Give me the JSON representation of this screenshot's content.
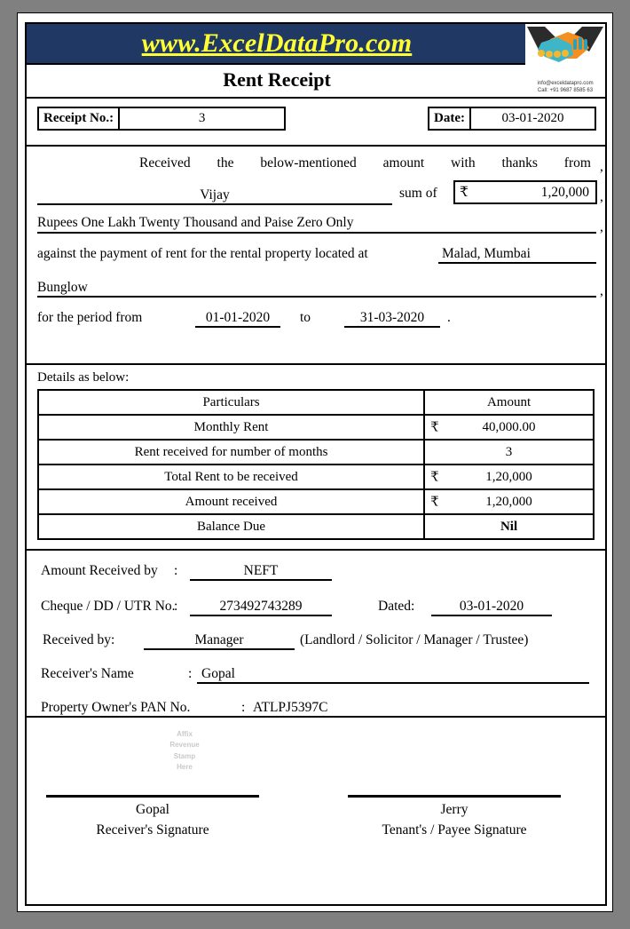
{
  "header": {
    "website": "www.ExcelDataPro.com",
    "doc_title": "Rent Receipt",
    "logo_icon": "handshake-icon",
    "logo_email": "info@exceldatapro.com",
    "logo_phone": "Call: +91 9687 8585 63"
  },
  "meta": {
    "receipt_no_label": "Receipt No.:",
    "receipt_no_value": "3",
    "date_label": "Date:",
    "date_value": "03-01-2020"
  },
  "body": {
    "intro_words": [
      "Received",
      "the",
      "below-mentioned",
      "amount",
      "with",
      "thanks",
      "from"
    ],
    "comma1": ",",
    "payer_name": "Vijay",
    "sum_of_label": "sum of",
    "currency_symbol": "₹",
    "amount_figures": "1,20,000",
    "comma2": ",",
    "amount_words": "Rupees  One Lakh Twenty  Thousand  and Paise Zero Only",
    "comma3": ",",
    "property_prefix": "against the payment of rent for the rental property located at",
    "property_line1": "Malad, Mumbai",
    "property_line2": "Bunglow",
    "comma4": ",",
    "period_prefix": "for the period from",
    "period_from": "01-01-2020",
    "period_to_label": "to",
    "period_to": "31-03-2020",
    "period_end": "."
  },
  "details": {
    "title": "Details as below:",
    "columns": [
      "Particulars",
      "Amount"
    ],
    "rows": [
      {
        "particular": "Monthly Rent",
        "symbol": "₹",
        "amount": "40,000.00",
        "bold": false
      },
      {
        "particular": "Rent received for number of months",
        "symbol": "",
        "amount": "3",
        "bold": false
      },
      {
        "particular": "Total Rent to be received",
        "symbol": "₹",
        "amount": "1,20,000",
        "bold": false
      },
      {
        "particular": "Amount received",
        "symbol": "₹",
        "amount": "1,20,000",
        "bold": false
      },
      {
        "particular": "Balance Due",
        "symbol": "",
        "amount": "Nil",
        "bold": true
      }
    ]
  },
  "payment": {
    "received_by_label": "Amount Received by",
    "received_by_colon": ":",
    "received_by_value": "NEFT",
    "cheque_label": "Cheque / DD / UTR No.",
    "cheque_colon": ":",
    "cheque_value": "273492743289",
    "dated_label": "Dated:",
    "dated_value": "03-01-2020",
    "receivedby2_label": "Received by:",
    "receivedby2_value": "Manager",
    "receivedby2_options": "(Landlord / Solicitor / Manager / Trustee)",
    "receiver_name_label": "Receiver's Name",
    "receiver_name_colon": ":",
    "receiver_name_value": "Gopal",
    "pan_label": "Property Owner's PAN No.",
    "pan_colon": ":",
    "pan_value": "ATLPJ5397C"
  },
  "footer": {
    "stamp_l1": "Affix",
    "stamp_l2": "Revenue",
    "stamp_l3": "Stamp",
    "stamp_l4": "Here",
    "receiver_sign_name": "Gopal",
    "receiver_sign_caption": "Receiver's Signature",
    "tenant_sign_name": "Jerry",
    "tenant_sign_caption": "Tenant's / Payee Signature"
  },
  "colors": {
    "banner_bg": "#1f3864",
    "banner_text": "#ffff33",
    "page_bg": "#808080",
    "stamp_text": "#c9c9c9"
  }
}
